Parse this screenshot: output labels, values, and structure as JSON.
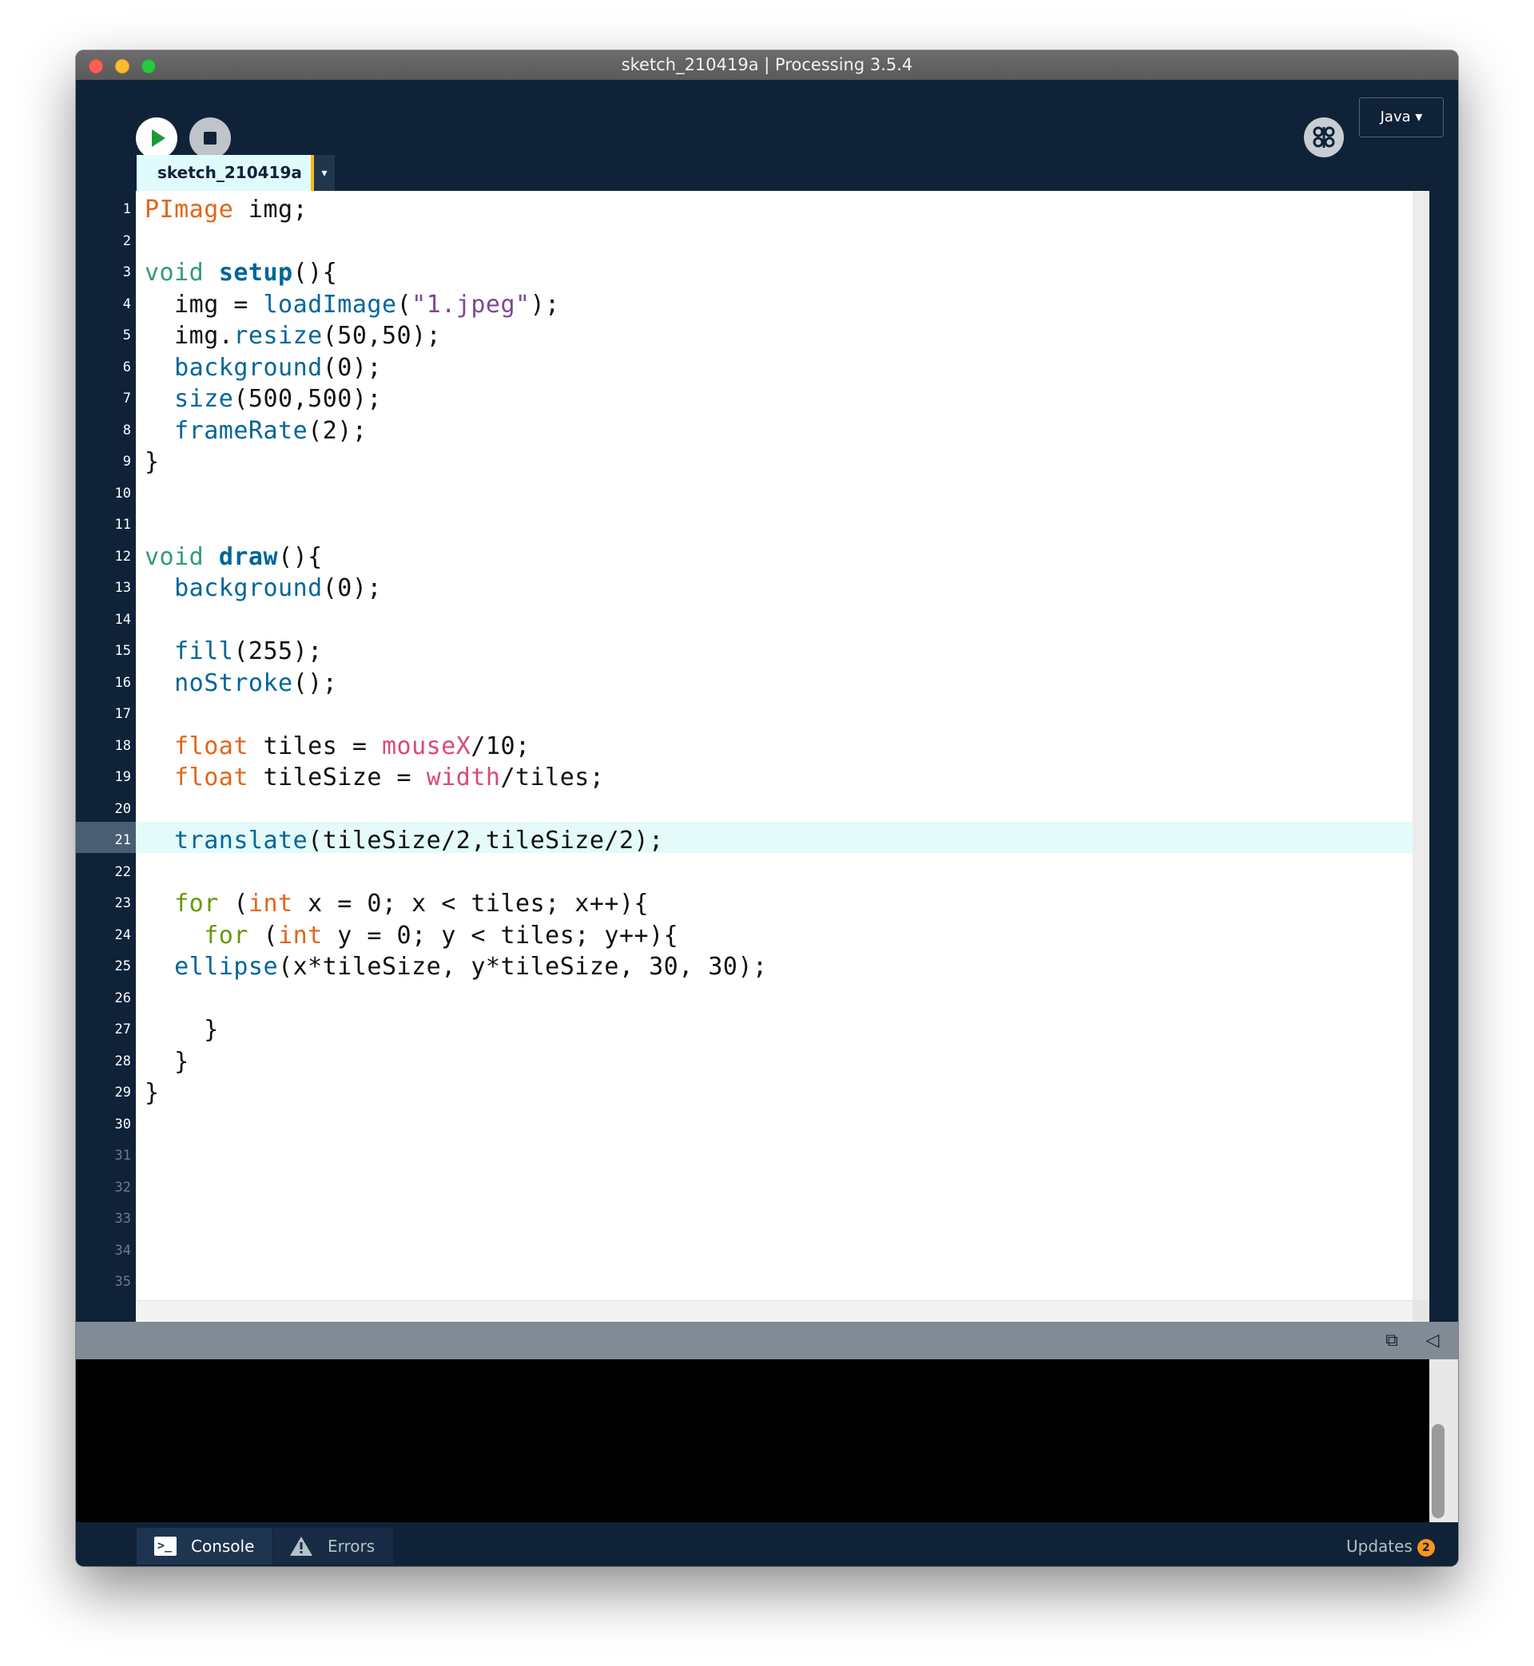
{
  "window": {
    "title": "sketch_210419a | Processing 3.5.4"
  },
  "toolbar": {
    "run_icon": "play-icon",
    "stop_icon": "stop-icon",
    "debug_icon": "butterfly-debug-icon",
    "mode": "Java ▾"
  },
  "tabs": [
    {
      "label": "sketch_210419a"
    }
  ],
  "tab_menu_label": "▾",
  "editor": {
    "current_line": 21,
    "line_numbers": [
      "1",
      "2",
      "3",
      "4",
      "5",
      "6",
      "7",
      "8",
      "9",
      "10",
      "11",
      "12",
      "13",
      "14",
      "15",
      "16",
      "17",
      "18",
      "19",
      "20",
      "21",
      "22",
      "23",
      "24",
      "25",
      "26",
      "27",
      "28",
      "29",
      "30",
      "31",
      "32",
      "33",
      "34",
      "35"
    ],
    "lines": [
      [
        [
          "t-type",
          "PImage"
        ],
        [
          "t-pl",
          " img;"
        ]
      ],
      [],
      [
        [
          "t-kw",
          "void"
        ],
        [
          "t-pl",
          " "
        ],
        [
          "t-fndef",
          "setup"
        ],
        [
          "t-pl",
          "(){"
        ]
      ],
      [
        [
          "t-pl",
          "  img = "
        ],
        [
          "t-fn",
          "loadImage"
        ],
        [
          "t-pl",
          "("
        ],
        [
          "t-str",
          "\"1.jpeg\""
        ],
        [
          "t-pl",
          ");"
        ]
      ],
      [
        [
          "t-pl",
          "  img."
        ],
        [
          "t-fn",
          "resize"
        ],
        [
          "t-pl",
          "(50,50);"
        ]
      ],
      [
        [
          "t-pl",
          "  "
        ],
        [
          "t-fn",
          "background"
        ],
        [
          "t-pl",
          "(0);"
        ]
      ],
      [
        [
          "t-pl",
          "  "
        ],
        [
          "t-fn",
          "size"
        ],
        [
          "t-pl",
          "(500,500);"
        ]
      ],
      [
        [
          "t-pl",
          "  "
        ],
        [
          "t-fn",
          "frameRate"
        ],
        [
          "t-pl",
          "(2);"
        ]
      ],
      [
        [
          "t-pl",
          "}"
        ]
      ],
      [],
      [],
      [
        [
          "t-kw",
          "void"
        ],
        [
          "t-pl",
          " "
        ],
        [
          "t-fndef",
          "draw"
        ],
        [
          "t-pl",
          "(){"
        ]
      ],
      [
        [
          "t-pl",
          "  "
        ],
        [
          "t-fn",
          "background"
        ],
        [
          "t-pl",
          "(0);"
        ]
      ],
      [],
      [
        [
          "t-pl",
          "  "
        ],
        [
          "t-fn",
          "fill"
        ],
        [
          "t-pl",
          "(255);"
        ]
      ],
      [
        [
          "t-pl",
          "  "
        ],
        [
          "t-fn",
          "noStroke"
        ],
        [
          "t-pl",
          "();"
        ]
      ],
      [],
      [
        [
          "t-pl",
          "  "
        ],
        [
          "t-type",
          "float"
        ],
        [
          "t-pl",
          " tiles = "
        ],
        [
          "t-var",
          "mouseX"
        ],
        [
          "t-pl",
          "/10;"
        ]
      ],
      [
        [
          "t-pl",
          "  "
        ],
        [
          "t-type",
          "float"
        ],
        [
          "t-pl",
          " tileSize = "
        ],
        [
          "t-var",
          "width"
        ],
        [
          "t-pl",
          "/tiles;"
        ]
      ],
      [],
      [
        [
          "t-pl",
          "  "
        ],
        [
          "t-fn",
          "translate"
        ],
        [
          "t-pl",
          "(tileSize/2,tileSize/2);"
        ]
      ],
      [],
      [
        [
          "t-pl",
          "  "
        ],
        [
          "t-ctrl",
          "for"
        ],
        [
          "t-pl",
          " ("
        ],
        [
          "t-type",
          "int"
        ],
        [
          "t-pl",
          " x = 0; x < tiles; x++){"
        ]
      ],
      [
        [
          "t-pl",
          "    "
        ],
        [
          "t-ctrl",
          "for"
        ],
        [
          "t-pl",
          " ("
        ],
        [
          "t-type",
          "int"
        ],
        [
          "t-pl",
          " y = 0; y < tiles; y++){"
        ]
      ],
      [
        [
          "t-pl",
          "  "
        ],
        [
          "t-fn",
          "ellipse"
        ],
        [
          "t-pl",
          "(x*tileSize, y*tileSize, 30, 30);"
        ]
      ],
      [],
      [
        [
          "t-pl",
          "    }"
        ]
      ],
      [
        [
          "t-pl",
          "  }"
        ]
      ],
      [
        [
          "t-pl",
          "}"
        ]
      ],
      [],
      [],
      [],
      [],
      [],
      []
    ]
  },
  "console": {
    "copy_icon": "copy-icon",
    "collapse_icon": "collapse-triangle-icon",
    "text": ""
  },
  "status": {
    "console_label": "Console",
    "errors_label": "Errors",
    "updates_label": "Updates",
    "updates_count": "2"
  }
}
